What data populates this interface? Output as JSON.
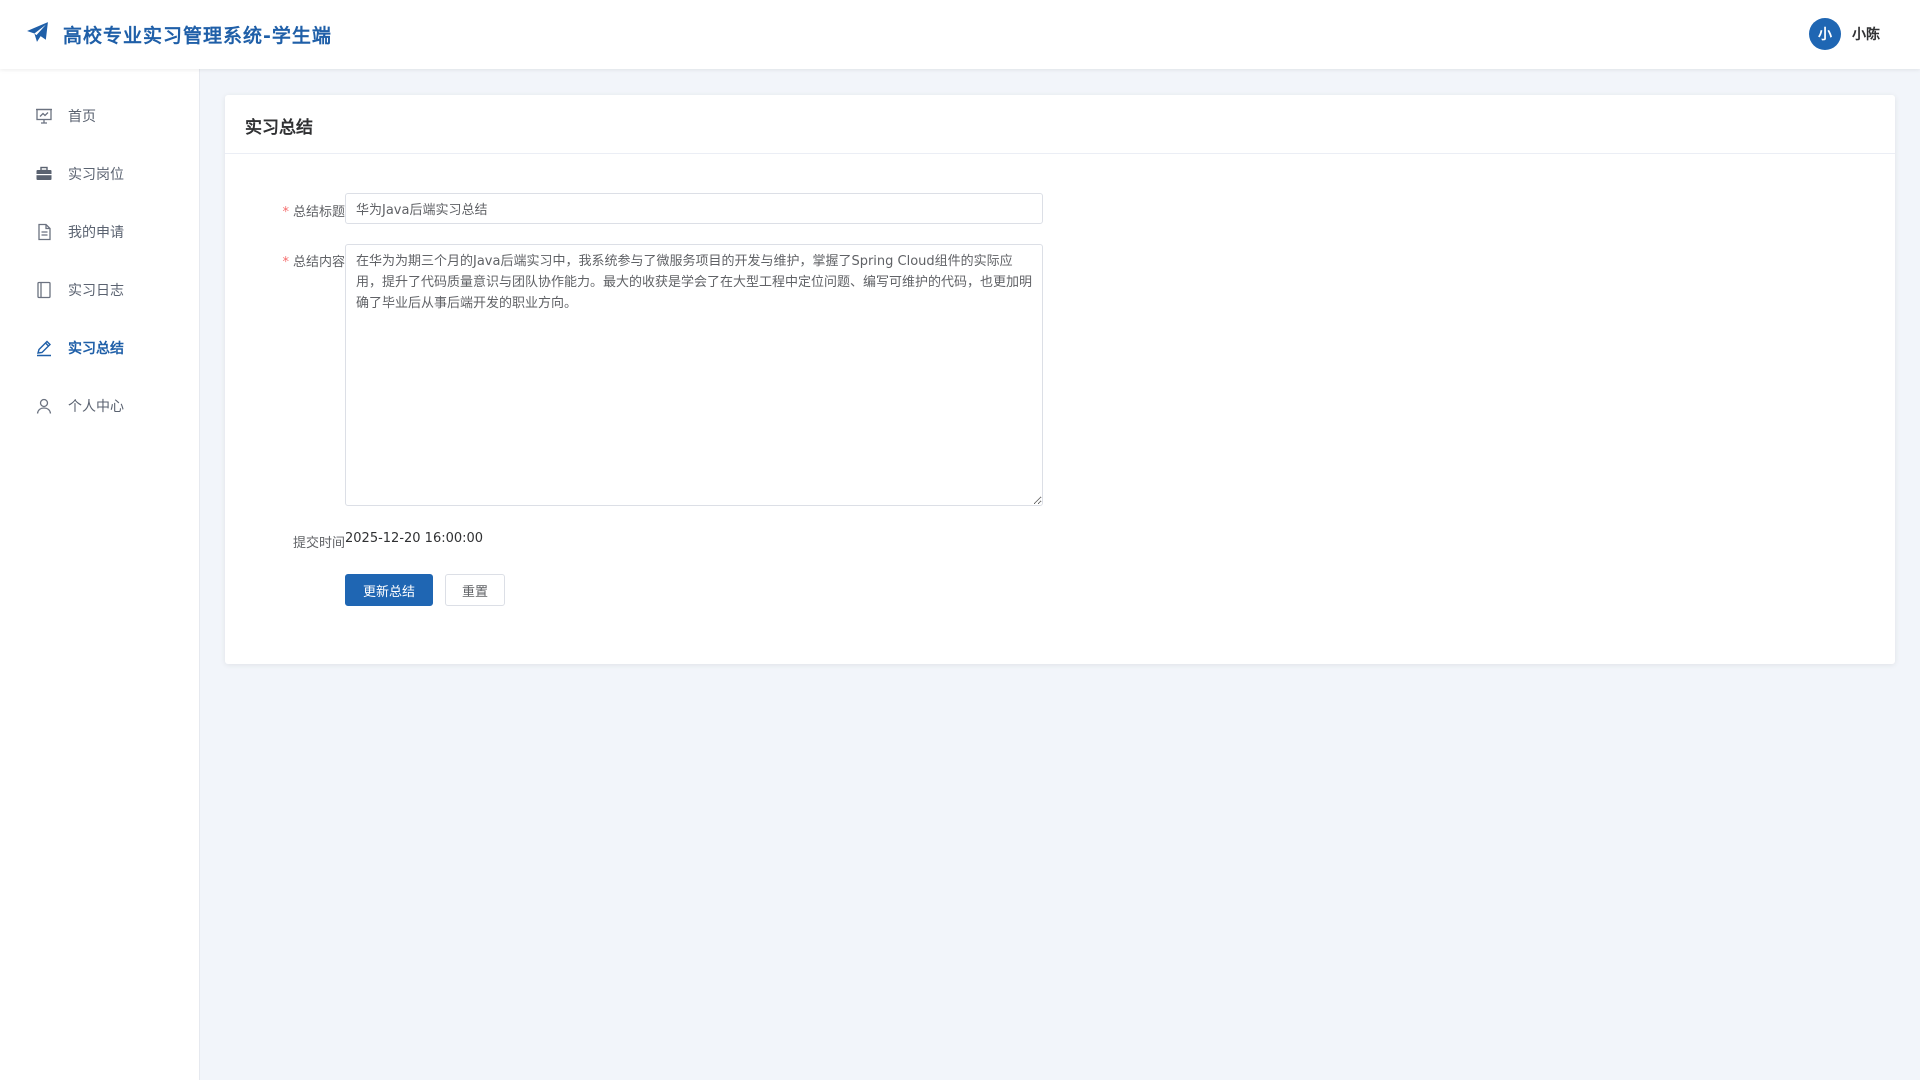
{
  "app": {
    "title": "高校专业实习管理系统-学生端",
    "logo_icon": "paper-plane-icon",
    "brand_color": "#1f5fa8"
  },
  "user": {
    "avatar_text": "小",
    "name": "小陈"
  },
  "sidebar": {
    "items": [
      {
        "label": "首页",
        "icon": "presentation-icon",
        "active": false
      },
      {
        "label": "实习岗位",
        "icon": "briefcase-icon",
        "active": false
      },
      {
        "label": "我的申请",
        "icon": "document-icon",
        "active": false
      },
      {
        "label": "实习日志",
        "icon": "notebook-icon",
        "active": false
      },
      {
        "label": "实习总结",
        "icon": "edit-pen-icon",
        "active": true
      },
      {
        "label": "个人中心",
        "icon": "user-icon",
        "active": false
      }
    ]
  },
  "main": {
    "card_title": "实习总结",
    "form": {
      "title_label": "总结标题",
      "title_value": "华为Java后端实习总结",
      "content_label": "总结内容",
      "content_value": "在华为为期三个月的Java后端实习中，我系统参与了微服务项目的开发与维护，掌握了Spring Cloud组件的实际应用，提升了代码质量意识与团队协作能力。最大的收获是学会了在大型工程中定位问题、编写可维护的代码，也更加明确了毕业后从事后端开发的职业方向。",
      "time_label": "提交时间",
      "time_value": "2025-12-20 16:00:00",
      "required_mark": "*"
    },
    "buttons": {
      "update": "更新总结",
      "reset": "重置"
    }
  },
  "colors": {
    "primary": "#1f66b3",
    "background": "#f2f5fa",
    "required": "#f56c6c"
  }
}
